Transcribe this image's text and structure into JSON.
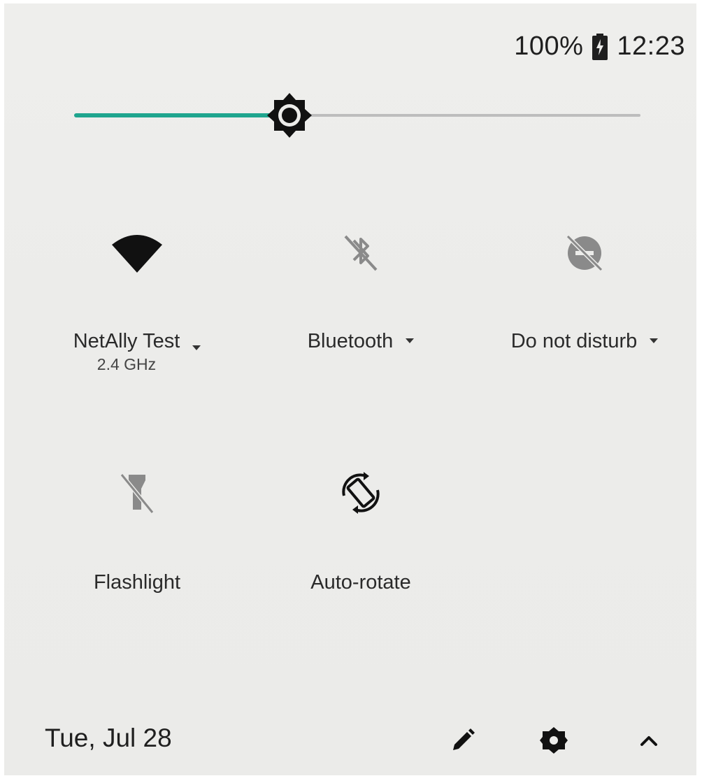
{
  "status_bar": {
    "battery_percent": "100%",
    "battery_icon": "battery-charging-icon",
    "time": "12:23"
  },
  "brightness": {
    "icon": "brightness-icon",
    "level": 0.38,
    "accent_color": "#1fa58e"
  },
  "tiles": [
    {
      "id": "wifi",
      "label": "NetAlly Test",
      "sublabel": "2.4 GHz",
      "icon": "wifi-icon",
      "active": true,
      "has_dropdown": true
    },
    {
      "id": "bluetooth",
      "label": "Bluetooth",
      "icon": "bluetooth-off-icon",
      "active": false,
      "has_dropdown": true
    },
    {
      "id": "dnd",
      "label": "Do not disturb",
      "icon": "do-not-disturb-off-icon",
      "active": false,
      "has_dropdown": true
    },
    {
      "id": "flashlight",
      "label": "Flashlight",
      "icon": "flashlight-off-icon",
      "active": false,
      "has_dropdown": false
    },
    {
      "id": "autorotate",
      "label": "Auto-rotate",
      "icon": "auto-rotate-icon",
      "active": true,
      "has_dropdown": false
    }
  ],
  "footer": {
    "date": "Tue, Jul 28",
    "edit_icon": "pencil-icon",
    "settings_icon": "gear-icon",
    "collapse_icon": "chevron-up-icon"
  }
}
